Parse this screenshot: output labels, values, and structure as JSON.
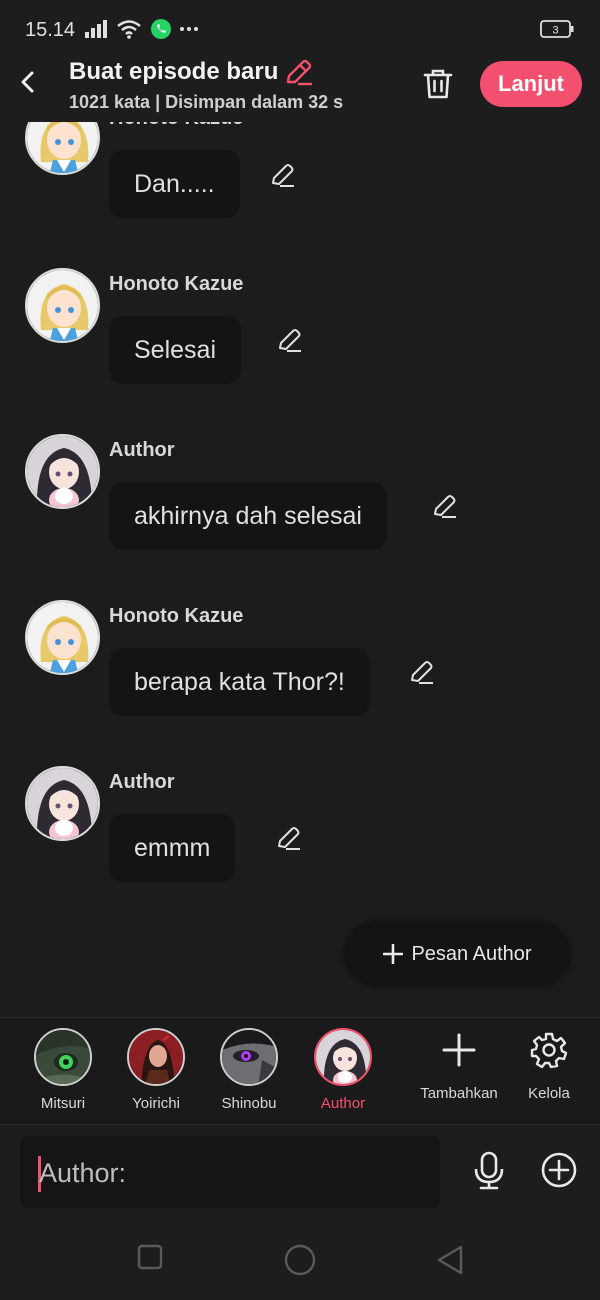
{
  "status": {
    "time": "15.14",
    "battery": "3"
  },
  "header": {
    "title": "Buat episode baru",
    "subtitle": "1021 kata | Disimpan dalam 32 s",
    "next_label": "Lanjut"
  },
  "messages": [
    {
      "sender": "Honoto Kazue",
      "text": "Dan....."
    },
    {
      "sender": "Honoto Kazue",
      "text": "Selesai"
    },
    {
      "sender": "Author",
      "text": "akhirnya dah selesai"
    },
    {
      "sender": "Honoto Kazue",
      "text": "berapa kata Thor?!"
    },
    {
      "sender": "Author",
      "text": "emmm"
    }
  ],
  "fab": {
    "label": "Pesan Author"
  },
  "characters": [
    {
      "name": "Mitsuri",
      "active": false
    },
    {
      "name": "Yoirichi",
      "active": false
    },
    {
      "name": "Shinobu",
      "active": false
    },
    {
      "name": "Author",
      "active": true
    }
  ],
  "tools": {
    "add_label": "Tambahkan",
    "manage_label": "Kelola"
  },
  "input": {
    "value": "Author:"
  },
  "colors": {
    "accent": "#f2506e",
    "background": "#1c1c1c",
    "bubble": "#141414"
  }
}
